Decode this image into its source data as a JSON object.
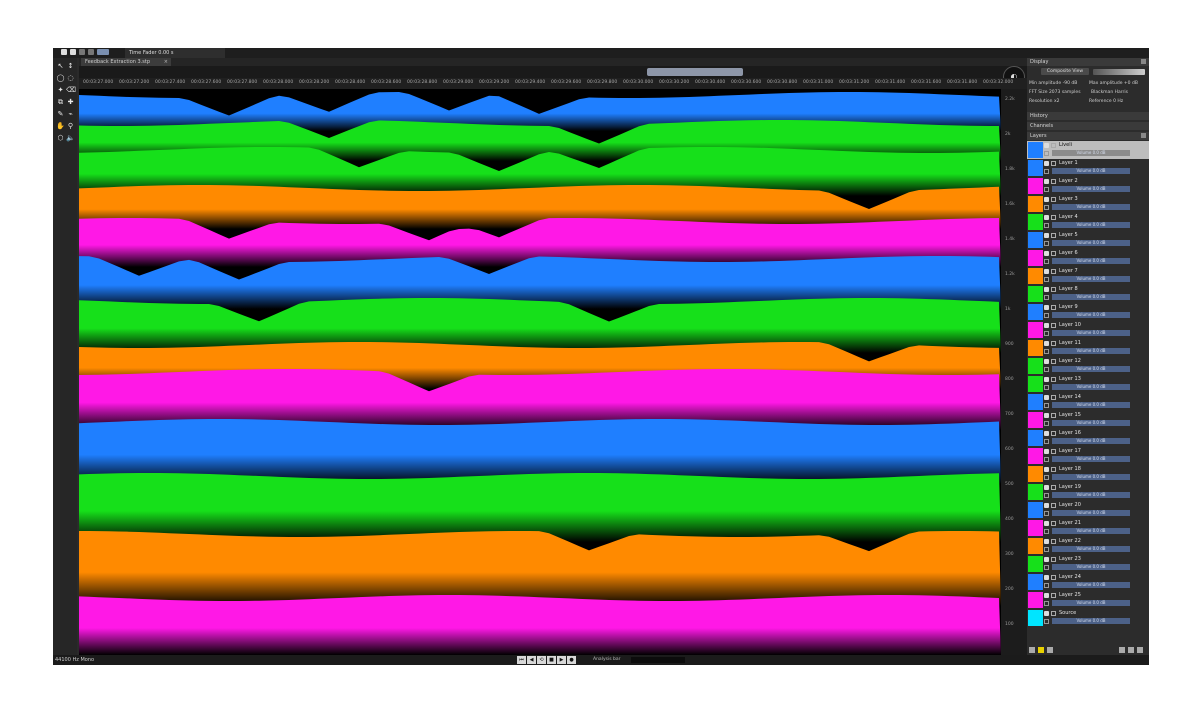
{
  "app": {
    "doc_tab": "Time Fader 0.00 s",
    "file_tab": "Feedback Extraction 3.stp",
    "close_glyph": "×"
  },
  "timeline": {
    "labels": [
      "00:03:27.000",
      "00:03:27.200",
      "00:03:27.400",
      "00:03:27.600",
      "00:03:27.800",
      "00:03:28.000",
      "00:03:28.200",
      "00:03:28.400",
      "00:03:28.600",
      "00:03:28.800",
      "00:03:29.000",
      "00:03:29.200",
      "00:03:29.400",
      "00:03:29.600",
      "00:03:29.800",
      "00:03:30.000",
      "00:03:30.200",
      "00:03:30.400",
      "00:03:30.600",
      "00:03:30.800",
      "00:03:31.000",
      "00:03:31.200",
      "00:03:31.400",
      "00:03:31.600",
      "00:03:31.800",
      "00:03:32.000"
    ]
  },
  "vruler": {
    "labels": [
      "2.2k",
      "2k",
      "1.8k",
      "1.6k",
      "1.4k",
      "1.2k",
      "1k",
      "900",
      "800",
      "700",
      "600",
      "500",
      "400",
      "300",
      "200",
      "100"
    ]
  },
  "tools": {
    "icons": [
      "arrow-select-icon",
      "time-select-icon",
      "lasso-icon",
      "brush-select-icon",
      "magic-wand-icon",
      "eraser-icon",
      "clone-stamp-icon",
      "spectral-heal-icon",
      "pencil-icon",
      "dropper-icon",
      "hand-icon",
      "zoom-icon",
      "transform-icon",
      "speaker-icon"
    ]
  },
  "display": {
    "title": "Display",
    "composite_view": "Composite View",
    "min_amplitude": "Min amplitude  -90 dB",
    "max_amplitude": "Max amplitude  +0 dB",
    "fft": "FFT Size 2073 samples",
    "fft_value": "Blackman Harris",
    "resolution": "Resolution x2",
    "reference": "Reference 0 Hz"
  },
  "history": {
    "title": "History"
  },
  "channels": {
    "title": "Channels"
  },
  "layers": {
    "title": "Layers",
    "items": [
      {
        "name": "Liveli",
        "volume": "Volume 0.0 dB",
        "color": "#1f7fff",
        "selected": true
      },
      {
        "name": "Layer 1",
        "volume": "Volume 0.0 dB",
        "color": "#1f7fff"
      },
      {
        "name": "Layer 2",
        "volume": "Volume 0.0 dB",
        "color": "#ff18e6"
      },
      {
        "name": "Layer 3",
        "volume": "Volume 0.0 dB",
        "color": "#ff8a00"
      },
      {
        "name": "Layer 4",
        "volume": "Volume 0.0 dB",
        "color": "#16e01a"
      },
      {
        "name": "Layer 5",
        "volume": "Volume 0.0 dB",
        "color": "#1f7fff"
      },
      {
        "name": "Layer 6",
        "volume": "Volume 0.0 dB",
        "color": "#ff18e6"
      },
      {
        "name": "Layer 7",
        "volume": "Volume 0.0 dB",
        "color": "#ff8a00"
      },
      {
        "name": "Layer 8",
        "volume": "Volume 0.0 dB",
        "color": "#16e01a"
      },
      {
        "name": "Layer 9",
        "volume": "Volume 0.0 dB",
        "color": "#1f7fff"
      },
      {
        "name": "Layer 10",
        "volume": "Volume 0.0 dB",
        "color": "#ff18e6"
      },
      {
        "name": "Layer 11",
        "volume": "Volume 0.0 dB",
        "color": "#ff8a00"
      },
      {
        "name": "Layer 12",
        "volume": "Volume 0.0 dB",
        "color": "#16e01a"
      },
      {
        "name": "Layer 13",
        "volume": "Volume 0.0 dB",
        "color": "#16e01a"
      },
      {
        "name": "Layer 14",
        "volume": "Volume 0.0 dB",
        "color": "#1f7fff"
      },
      {
        "name": "Layer 15",
        "volume": "Volume 0.0 dB",
        "color": "#ff18e6"
      },
      {
        "name": "Layer 16",
        "volume": "Volume 0.0 dB",
        "color": "#1f7fff"
      },
      {
        "name": "Layer 17",
        "volume": "Volume 0.0 dB",
        "color": "#ff18e6"
      },
      {
        "name": "Layer 18",
        "volume": "Volume 0.0 dB",
        "color": "#ff8a00"
      },
      {
        "name": "Layer 19",
        "volume": "Volume 0.0 dB",
        "color": "#16e01a"
      },
      {
        "name": "Layer 20",
        "volume": "Volume 0.0 dB",
        "color": "#1f7fff"
      },
      {
        "name": "Layer 21",
        "volume": "Volume 0.0 dB",
        "color": "#ff18e6"
      },
      {
        "name": "Layer 22",
        "volume": "Volume 0.0 dB",
        "color": "#ff8a00"
      },
      {
        "name": "Layer 23",
        "volume": "Volume 0.0 dB",
        "color": "#16e01a"
      },
      {
        "name": "Layer 24",
        "volume": "Volume 0.0 dB",
        "color": "#1f7fff"
      },
      {
        "name": "Layer 25",
        "volume": "Volume 0.0 dB",
        "color": "#ff18e6"
      },
      {
        "name": "Source",
        "volume": "Volume 0.0 dB",
        "color": "#00e5ff"
      }
    ]
  },
  "status": {
    "format": "44100 Hz Mono",
    "processing": "Analysis bar"
  },
  "spectrogram": {
    "band_colors": [
      "#1f7fff",
      "#16e01a",
      "#16e01a",
      "#ff8a00",
      "#ff18e6",
      "#1f7fff",
      "#16e01a",
      "#ff8a00",
      "#ff18e6",
      "#1f7fff",
      "#16e01a",
      "#ff8a00",
      "#ff18e6"
    ]
  }
}
